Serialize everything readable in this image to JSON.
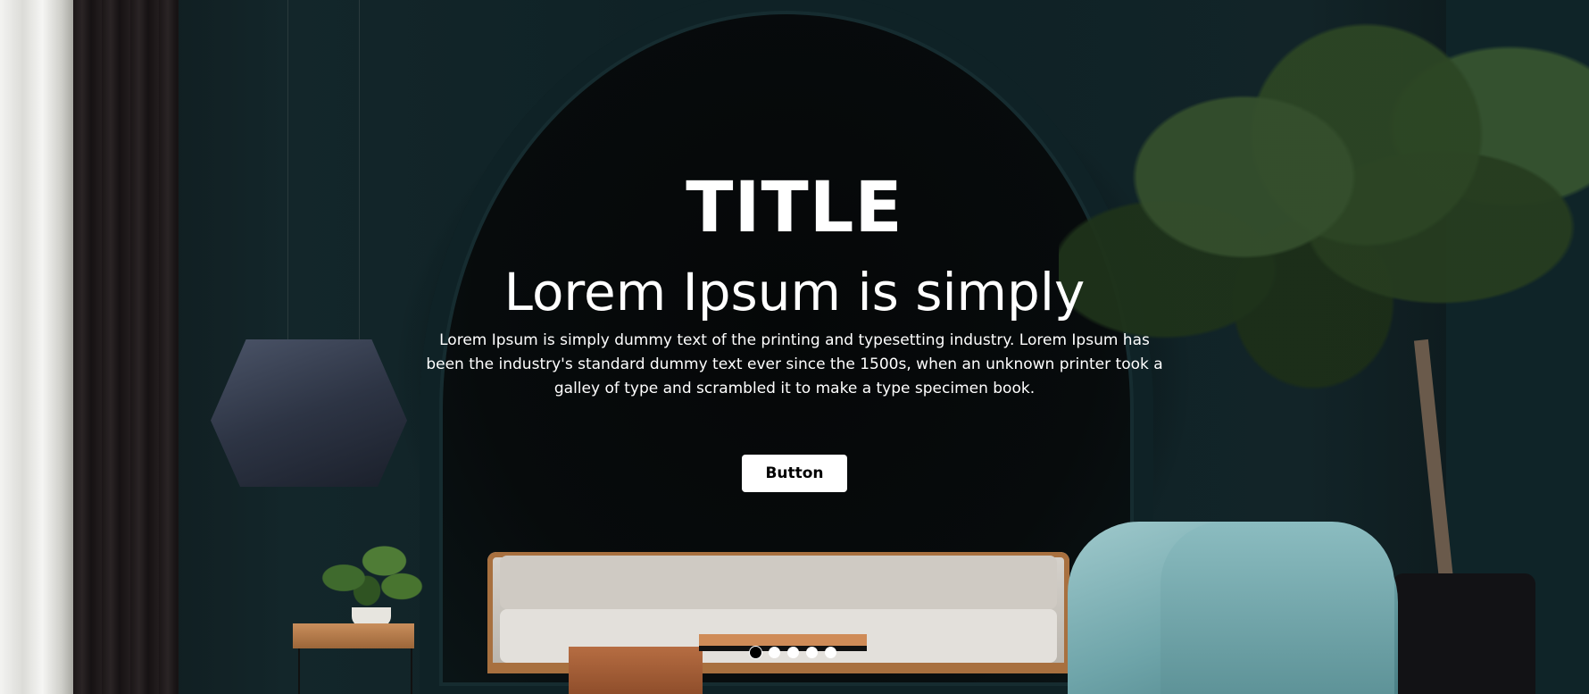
{
  "hero": {
    "title": "TITLE",
    "subtitle": "Lorem Ipsum is simply",
    "description": "Lorem Ipsum is simply dummy text of the printing and typesetting industry. Lorem Ipsum has been the industry's standard dummy text ever since the 1500s, when an unknown printer took a galley of type and scrambled it to make a type specimen book.",
    "button_label": "Button"
  },
  "carousel": {
    "slide_count": 5,
    "active_index": 0
  },
  "colors": {
    "text": "#ffffff",
    "button_bg": "#ffffff",
    "button_text": "#000000",
    "wall": "#0f2226"
  }
}
